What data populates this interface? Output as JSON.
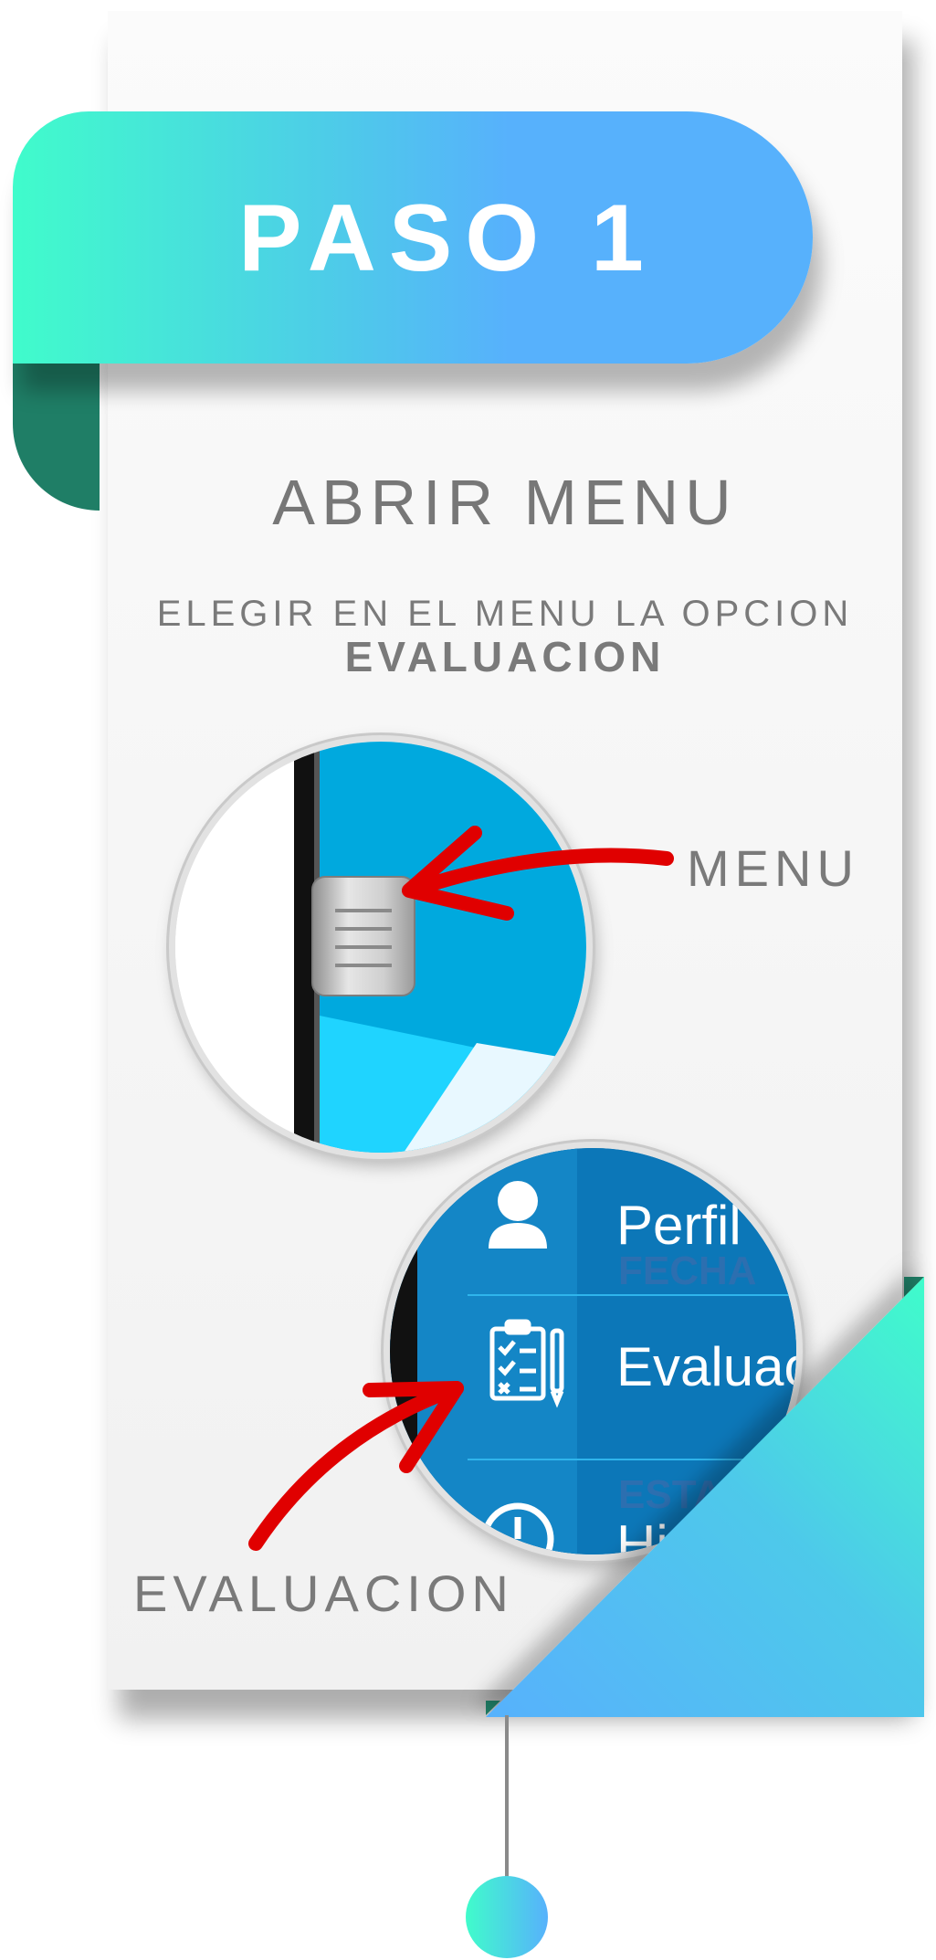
{
  "colors": {
    "gradient_start": "#40fccb",
    "gradient_end": "#57b1fc",
    "ribbon_fold": "#1f7e66",
    "text_gray": "#777777",
    "arrow_red": "#e00000",
    "menu_blue": "#0c77b8"
  },
  "ribbon": {
    "title": "PASO 1"
  },
  "heading": {
    "title": "ABRIR MENU"
  },
  "instructions": {
    "line1": "ELEGIR EN EL MENU LA OPCION",
    "line2": "EVALUACION"
  },
  "callouts": {
    "menu_label": "MENU",
    "evaluacion_label": "EVALUACION"
  },
  "zoom_menu": {
    "icon": "hamburger-menu-icon"
  },
  "zoom_list": {
    "items": [
      {
        "label": "Perfil",
        "icon": "user-icon",
        "ghost": "FECHA"
      },
      {
        "label": "Evaluacion",
        "icon": "clipboard-checklist-icon",
        "ghost": ""
      },
      {
        "label": "Historial",
        "icon": "clock-icon",
        "ghost": "ESTA"
      }
    ]
  }
}
